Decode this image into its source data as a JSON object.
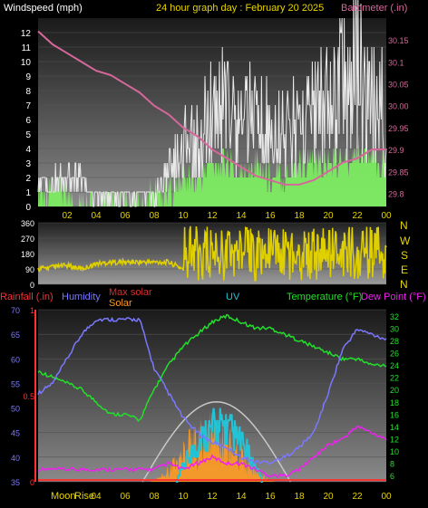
{
  "colors": {
    "wind": "#e8e8e8",
    "gust_fill": "#7cf25f",
    "baro": "#d6679a",
    "dir": "#e0d000",
    "rain": "#ff3030",
    "humidity": "#7a78ff",
    "max_solar": "#c8c8c8",
    "solar": "#ff9a20",
    "uv": "#22c3d6",
    "temp": "#22e02a",
    "dew": "#ee22ee",
    "yellow_text": "#e8d400",
    "white_text": "#ffffff"
  },
  "header": {
    "wind_label": "Windspeed (mph)",
    "title": "24 hour graph day : February 20 2025",
    "baro_label": "Barometer (.in)"
  },
  "bottom_header": {
    "rain_label": "Rainfall (.in)",
    "humidity_label": "Humidity",
    "max_solar_label": "Max solar",
    "solar_label": "Solar",
    "uv_label": "UV",
    "temp_label": "Temperature (°F)",
    "dew_label": "Dew Point (°F)"
  },
  "compass": [
    "N",
    "W",
    "S",
    "E",
    "N"
  ],
  "x_ticks": [
    "02",
    "04",
    "06",
    "08",
    "10",
    "12",
    "14",
    "16",
    "18",
    "20",
    "22",
    "00"
  ],
  "x_ticks_bottom": [
    "02",
    "04",
    "06",
    "08",
    "10",
    "12",
    "14",
    "16",
    "18",
    "20",
    "22",
    "00"
  ],
  "moon_rise_label": "Moon",
  "sun_rise_label": "Rise",
  "chart_data": [
    {
      "type": "line",
      "title": "24 hour graph day : February 20 2025",
      "panel": "wind_baro",
      "x_hours": [
        0,
        24
      ],
      "y_left": {
        "label": "Windspeed (mph)",
        "range": [
          0,
          13
        ],
        "ticks": [
          0,
          1,
          2,
          3,
          4,
          5,
          6,
          7,
          8,
          9,
          10,
          11,
          12
        ]
      },
      "y_right": {
        "label": "Barometer (.in)",
        "range": [
          29.77,
          30.2
        ],
        "ticks": [
          29.8,
          29.85,
          29.9,
          29.95,
          30,
          30.05,
          30.1,
          30.15
        ]
      },
      "series": [
        {
          "name": "Barometer",
          "x": [
            0,
            1,
            2,
            3,
            4,
            5,
            6,
            7,
            8,
            9,
            10,
            11,
            12,
            13,
            14,
            15,
            16,
            17,
            18,
            19,
            20,
            21,
            22,
            23,
            24
          ],
          "values": [
            30.17,
            30.14,
            30.12,
            30.1,
            30.08,
            30.07,
            30.05,
            30.03,
            30.0,
            29.98,
            29.95,
            29.93,
            29.9,
            29.88,
            29.86,
            29.84,
            29.83,
            29.82,
            29.82,
            29.83,
            29.85,
            29.87,
            29.88,
            29.9,
            29.9
          ]
        },
        {
          "name": "Windspeed",
          "x": [
            0,
            1,
            2,
            3,
            4,
            5,
            6,
            7,
            8,
            9,
            10,
            11,
            12,
            13,
            14,
            15,
            16,
            17,
            18,
            19,
            20,
            21,
            22,
            23,
            24
          ],
          "values": [
            2,
            2,
            3,
            2,
            1,
            1,
            1,
            1,
            1,
            3,
            5,
            6,
            8,
            9,
            7,
            8,
            7,
            6,
            7,
            8,
            9,
            10,
            12,
            9,
            8
          ]
        },
        {
          "name": "Gust",
          "x": [
            0,
            1,
            2,
            3,
            4,
            5,
            6,
            7,
            8,
            9,
            10,
            11,
            12,
            13,
            14,
            15,
            16,
            17,
            18,
            19,
            20,
            21,
            22,
            23,
            24
          ],
          "values": [
            1,
            1,
            1,
            0,
            0,
            0,
            0,
            0,
            1,
            1,
            2,
            2,
            3,
            3,
            2,
            3,
            2,
            2,
            3,
            3,
            3,
            3,
            4,
            3,
            3
          ]
        }
      ]
    },
    {
      "type": "scatter",
      "panel": "wind_direction",
      "y_range": [
        0,
        360
      ],
      "y_ticks": [
        0,
        90,
        180,
        270,
        360
      ],
      "series": [
        {
          "name": "Direction",
          "x": [
            0,
            1,
            2,
            3,
            4,
            5,
            6,
            7,
            8,
            9,
            10,
            11,
            12,
            13,
            14,
            15,
            16,
            17,
            18,
            19,
            20,
            21,
            22,
            23,
            24
          ],
          "values": [
            90,
            100,
            110,
            90,
            120,
            130,
            130,
            130,
            130,
            130,
            90,
            200,
            180,
            220,
            200,
            200,
            170,
            180,
            200,
            190,
            180,
            170,
            200,
            180,
            190
          ]
        }
      ]
    },
    {
      "type": "line",
      "panel": "temp_humidity_solar",
      "y_left_humidity": {
        "range": [
          35,
          70
        ],
        "ticks": [
          35,
          40,
          45,
          50,
          55,
          60,
          65,
          70
        ]
      },
      "y_left_rain": {
        "range": [
          0,
          1
        ],
        "ticks": [
          0,
          0.5,
          1
        ]
      },
      "y_right_temp": {
        "range": [
          5,
          33
        ],
        "ticks": [
          6,
          8,
          10,
          12,
          14,
          16,
          18,
          20,
          22,
          24,
          26,
          28,
          30,
          32
        ]
      },
      "series": [
        {
          "name": "Temperature",
          "x": [
            0,
            1,
            2,
            3,
            4,
            5,
            6,
            7,
            8,
            9,
            10,
            11,
            12,
            13,
            14,
            15,
            16,
            17,
            18,
            19,
            20,
            21,
            22,
            23,
            24
          ],
          "values": [
            23,
            22,
            21,
            20,
            18,
            16,
            16,
            15,
            20,
            24,
            27,
            29,
            31,
            32,
            31,
            30,
            30,
            29,
            28,
            27,
            26,
            25,
            25,
            24,
            24
          ]
        },
        {
          "name": "Humidity",
          "x": [
            0,
            1,
            2,
            3,
            4,
            5,
            6,
            7,
            8,
            9,
            10,
            11,
            12,
            13,
            14,
            15,
            16,
            17,
            18,
            19,
            20,
            21,
            22,
            23,
            24
          ],
          "values": [
            53,
            55,
            60,
            65,
            68,
            68,
            68,
            68,
            58,
            53,
            48,
            45,
            43,
            42,
            40,
            39,
            39,
            40,
            42,
            45,
            53,
            62,
            66,
            65,
            64
          ]
        },
        {
          "name": "Dew Point",
          "x": [
            0,
            1,
            2,
            3,
            4,
            5,
            6,
            7,
            8,
            9,
            10,
            11,
            12,
            13,
            14,
            15,
            16,
            17,
            18,
            19,
            20,
            21,
            22,
            23,
            24
          ],
          "values": [
            7,
            7,
            7,
            7,
            7,
            7,
            7,
            7,
            7,
            8,
            7,
            8,
            9,
            8,
            8,
            7,
            6,
            6,
            7,
            9,
            11,
            12,
            14,
            13,
            12
          ]
        },
        {
          "name": "Max solar",
          "x": [
            0,
            6,
            8,
            10,
            12,
            13,
            14,
            16,
            18,
            24
          ],
          "values": [
            0,
            0,
            5,
            10,
            12,
            12,
            11,
            5,
            0,
            0
          ]
        },
        {
          "name": "UV",
          "x": [
            10,
            11,
            12,
            12.5,
            13,
            14,
            15
          ],
          "values": [
            8,
            12,
            14,
            16,
            14,
            12,
            8
          ]
        }
      ]
    }
  ]
}
